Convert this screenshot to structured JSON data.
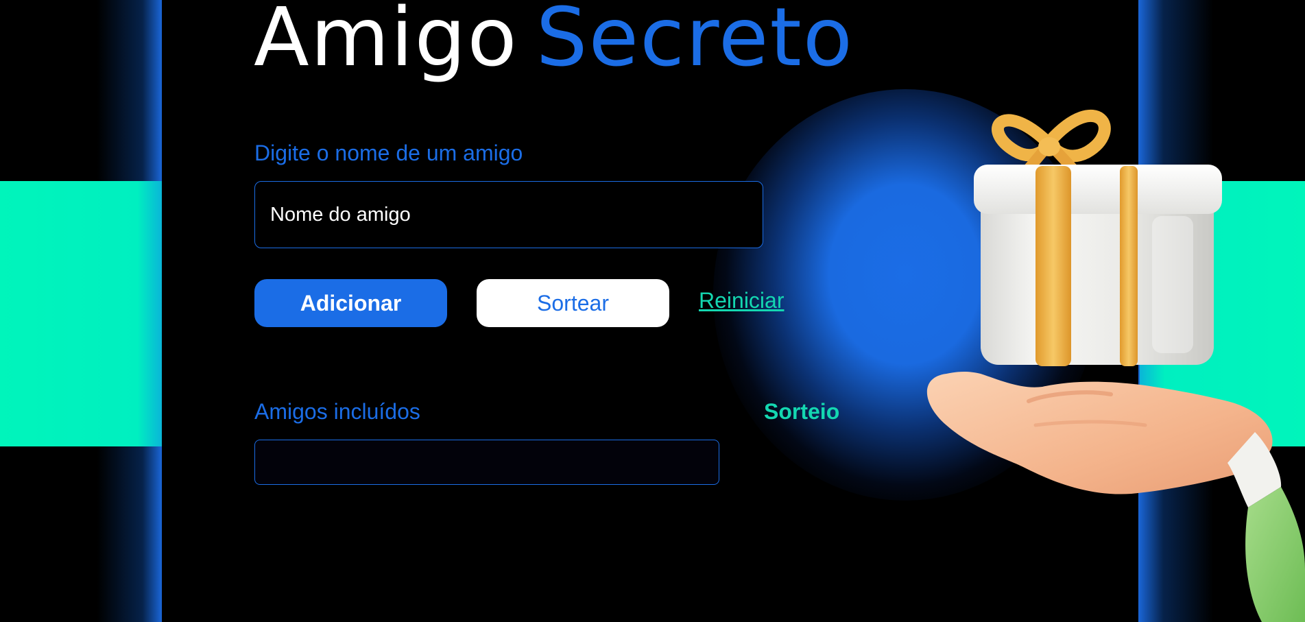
{
  "title": {
    "part1": "Amigo",
    "part2": "Secreto"
  },
  "form": {
    "name_label": "Digite o nome de um amigo",
    "name_placeholder": "Nome do amigo",
    "name_value": ""
  },
  "actions": {
    "add_label": "Adicionar",
    "draw_label": "Sortear",
    "reset_label": "Reiniciar"
  },
  "lists": {
    "included_label": "Amigos incluídos",
    "draw_result_label": "Sorteio",
    "included_items": [],
    "draw_items": []
  },
  "illustration": {
    "icon": "gift-on-hand-icon"
  },
  "colors": {
    "background": "#000000",
    "accent_blue": "#1b6de6",
    "accent_teal": "#14d7b1",
    "band_teal": "#00f5bb",
    "white": "#ffffff",
    "gift_gold": "#f2b74a"
  }
}
